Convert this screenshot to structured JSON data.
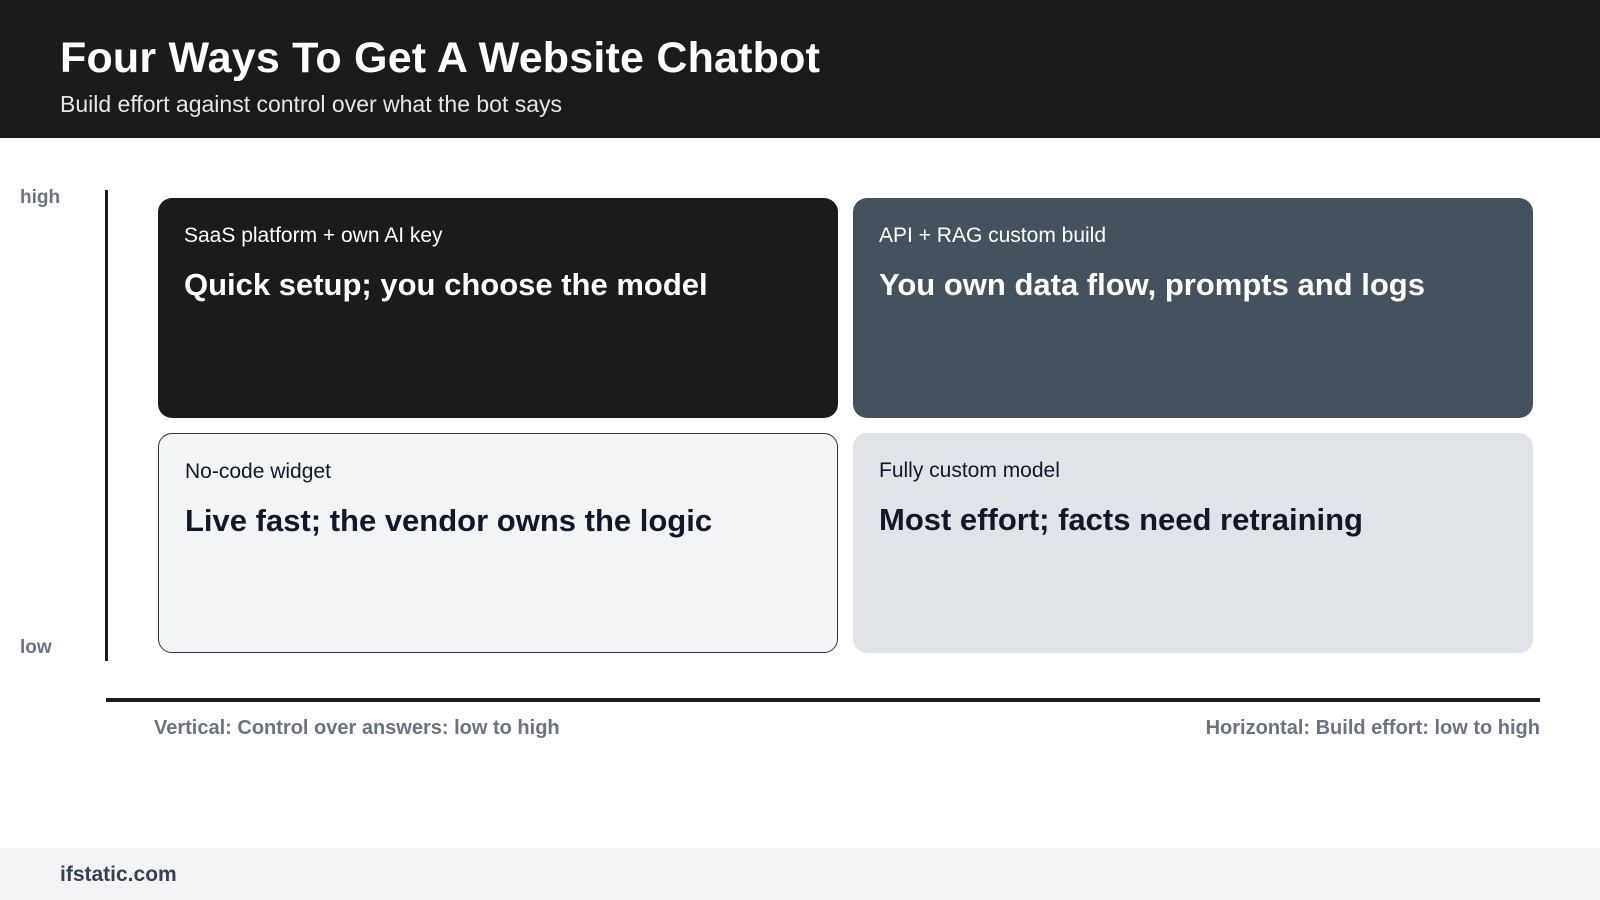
{
  "header": {
    "title": "Four Ways To Get A Website Chatbot",
    "subtitle": "Build effort against control over what the bot says"
  },
  "axis": {
    "high_label": "high",
    "low_label": "low",
    "vertical_caption": "Vertical: Control over answers: low to high",
    "horizontal_caption": "Horizontal: Build effort: low to high"
  },
  "quadrants": {
    "top_left": {
      "label": "SaaS platform + own AI key",
      "text": "Quick setup; you choose the model"
    },
    "top_right": {
      "label": "API + RAG custom build",
      "text": "You own data flow, prompts and logs"
    },
    "bottom_left": {
      "label": "No-code widget",
      "text": "Live fast; the vendor owns the logic"
    },
    "bottom_right": {
      "label": "Fully custom model",
      "text": "Most effort; facts need retraining"
    }
  },
  "footer": {
    "brand": "ifstatic.com"
  },
  "colors": {
    "dark": "#1b1b1c",
    "slate": "#46515e",
    "light": "#f3f4f6",
    "muted": "#e0e3e8",
    "caption_gray": "#6b7280"
  }
}
